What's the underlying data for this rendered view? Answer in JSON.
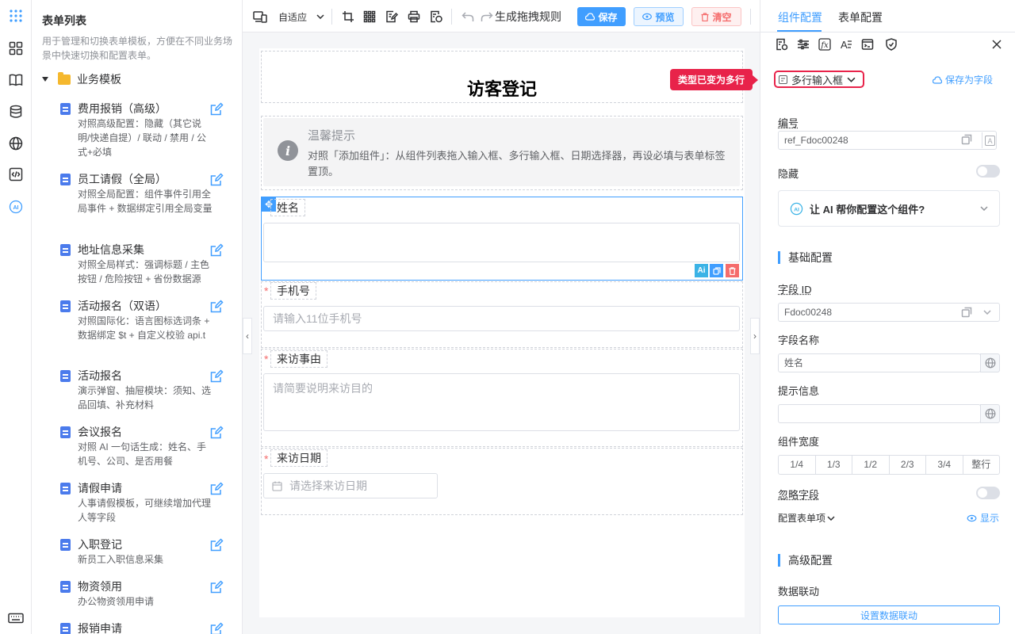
{
  "left_panel": {
    "title": "表单列表",
    "description": "用于管理和切换表单模板，方便在不同业务场景中快速切换和配置表单。",
    "folder": "业务模板",
    "templates": [
      {
        "name": "费用报销（高级）",
        "desc": "对照高级配置：隐藏（其它说明/快递自提）/ 联动 / 禁用 / 公式+必填"
      },
      {
        "name": "员工请假（全局）",
        "desc": "对照全局配置：组件事件引用全局事件 + 数据绑定引用全局变量"
      },
      {
        "name": "地址信息采集",
        "desc": "对照全局样式：强调标题 / 主色按钮 / 危险按钮 + 省份数据源"
      },
      {
        "name": "活动报名（双语）",
        "desc": "对照国际化：语言图标选词条 + 数据绑定 $t + 自定义校验 api.t"
      },
      {
        "name": "活动报名",
        "desc": "演示弹窗、抽屉模块：须知、选品回填、补充材料"
      },
      {
        "name": "会议报名",
        "desc": "对照 AI 一句话生成：姓名、手机号、公司、是否用餐"
      },
      {
        "name": "请假申请",
        "desc": "人事请假模板，可继续增加代理人等字段"
      },
      {
        "name": "入职登记",
        "desc": "新员工入职信息采集"
      },
      {
        "name": "物资领用",
        "desc": "办公物资领用申请"
      },
      {
        "name": "报销申请",
        "desc": ""
      }
    ]
  },
  "toolbar": {
    "adaptive": "自适应",
    "generate_rules": "生成拖拽规则",
    "save": "保存",
    "preview": "预览",
    "clear": "清空"
  },
  "form": {
    "title": "访客登记",
    "tip_title": "温馨提示",
    "tip_text": "对照「添加组件」：从组件列表拖入输入框、多行输入框、日期选择器，再设必填与表单标签置顶。",
    "fields": [
      {
        "label": "姓名",
        "placeholder": "",
        "required": false
      },
      {
        "label": "手机号",
        "placeholder": "请输入11位手机号",
        "required": true
      },
      {
        "label": "来访事由",
        "placeholder": "请简要说明来访目的",
        "required": true
      },
      {
        "label": "来访日期",
        "placeholder": "请选择来访日期",
        "required": true
      }
    ],
    "required_mark": "*",
    "ai_badge": "Ai"
  },
  "config": {
    "tab_component": "组件配置",
    "tab_form": "表单配置",
    "tooltip": "类型已变为多行",
    "type_value": "多行输入框",
    "save_as_field": "保存为字段",
    "id_label": "编号",
    "id_value": "ref_Fdoc00248",
    "hidden_label": "隐藏",
    "ai_prompt": "让 AI 帮你配置这个组件?",
    "basic_section": "基础配置",
    "field_id_label": "字段 ID",
    "field_id_value": "Fdoc00248",
    "field_name_label": "字段名称",
    "field_name_value": "姓名",
    "hint_label": "提示信息",
    "hint_value": "",
    "width_label": "组件宽度",
    "width_options": [
      "1/4",
      "1/3",
      "1/2",
      "2/3",
      "3/4",
      "整行"
    ],
    "ignore_label": "忽略字段",
    "form_items_label": "配置表单项",
    "show_label": "显示",
    "advanced_section": "高级配置",
    "linkage_label": "数据联动",
    "linkage_button": "设置数据联动"
  },
  "colors": {
    "accent": "#409eff",
    "danger": "#f56c6c",
    "highlight": "#e8234a",
    "folder": "#f5b82e"
  }
}
